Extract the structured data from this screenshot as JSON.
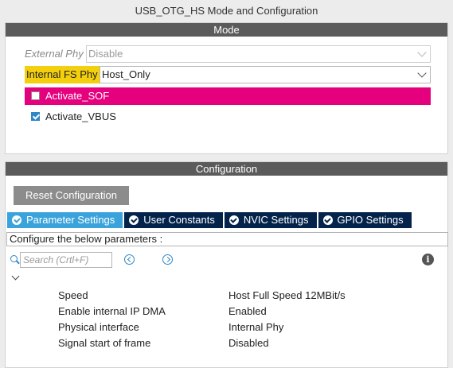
{
  "window": {
    "title": "USB_OTG_HS Mode and Configuration"
  },
  "mode": {
    "header": "Mode",
    "external_phy": {
      "label": "External Phy",
      "value": "Disable",
      "enabled": false
    },
    "internal_fs_phy": {
      "label": "Internal FS Phy",
      "value": "Host_Only",
      "highlighted": true
    },
    "activate_sof": {
      "label": "Activate_SOF",
      "checked": false
    },
    "activate_vbus": {
      "label": "Activate_VBUS",
      "checked": true
    }
  },
  "configuration": {
    "header": "Configuration",
    "reset_button": "Reset Configuration",
    "tabs": [
      {
        "label": "Parameter Settings",
        "active": true
      },
      {
        "label": "User Constants",
        "active": false
      },
      {
        "label": "NVIC Settings",
        "active": false
      },
      {
        "label": "GPIO Settings",
        "active": false
      }
    ],
    "info_text": "Configure the below parameters :",
    "search": {
      "placeholder": "Search (Crtl+F)"
    },
    "parameters": [
      {
        "name": "Speed",
        "value": "Host Full Speed 12MBit/s"
      },
      {
        "name": "Enable internal IP DMA",
        "value": "Enabled"
      },
      {
        "name": "Physical interface",
        "value": "Internal Phy"
      },
      {
        "name": "Signal start of frame",
        "value": "Disabled"
      }
    ]
  },
  "colors": {
    "header_bg": "#5b5b5b",
    "highlight_yellow": "#f3cf0d",
    "pink_row": "#e5007e",
    "active_tab": "#3ba3db",
    "inactive_tab": "#03234b",
    "reset_button_bg": "#8c8c8c"
  }
}
